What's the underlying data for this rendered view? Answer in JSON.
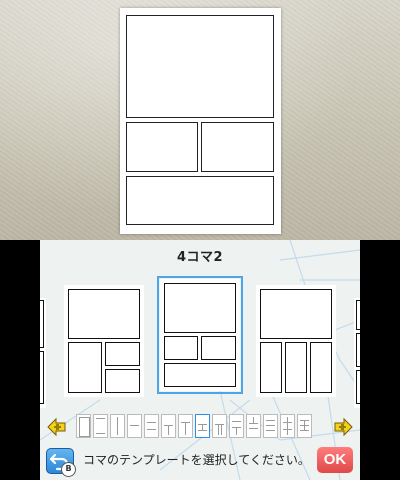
{
  "bottom": {
    "title": "4コマ2",
    "help_button_badge": "B",
    "message": "コマのテンプレートを選択してください。",
    "ok_label": "OK"
  },
  "icons": {
    "left_arrow": "left-arrow-icon",
    "right_arrow": "right-arrow-icon",
    "help": "back-icon"
  },
  "colors": {
    "selection": "#4aa6e8",
    "ok_button": "#e04848",
    "arrow": "#f2d21b"
  }
}
